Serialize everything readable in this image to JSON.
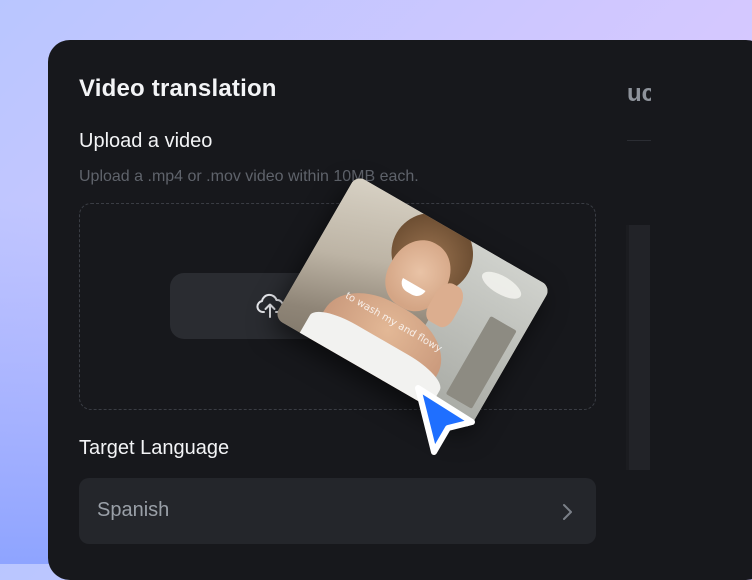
{
  "panel": {
    "title": "Video translation",
    "upload": {
      "label": "Upload a video",
      "hint": "Upload a .mp4 or .mov video within 10MB each.",
      "button_icon": "cloud-upload-icon"
    },
    "target_language": {
      "label": "Target Language",
      "selected": "Spanish",
      "icon": "chevron-right-icon"
    }
  },
  "side_panel": {
    "tab_fragment": "uc"
  },
  "video_card": {
    "caption": "to wash my and flowy"
  },
  "colors": {
    "panel_bg": "#17181c",
    "accent_cursor": "#1f6fff",
    "text_primary": "#f3f4f6",
    "text_muted": "#5f636b"
  }
}
